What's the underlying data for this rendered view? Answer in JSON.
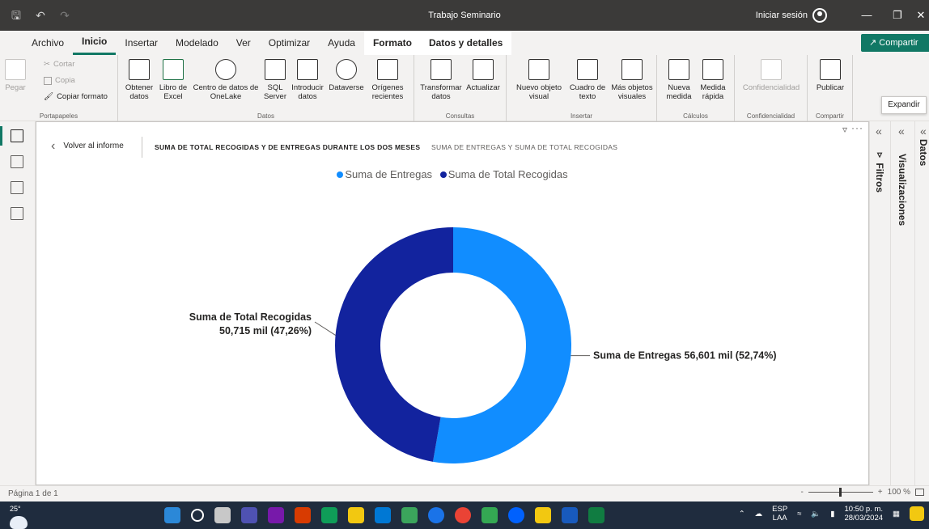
{
  "window": {
    "title": "Trabajo Seminario",
    "signin": "Iniciar sesión"
  },
  "menu": {
    "items": [
      "Archivo",
      "Inicio",
      "Insertar",
      "Modelado",
      "Ver",
      "Optimizar",
      "Ayuda",
      "Formato",
      "Datos y detalles"
    ],
    "share": "Compartir"
  },
  "ribbon": {
    "portapapeles": {
      "label": "Portapapeles",
      "pegar": "Pegar",
      "cortar": "Cortar",
      "copia": "Copia",
      "copiar_formato": "Copiar formato"
    },
    "datos": {
      "label": "Datos",
      "obtener": "Obtener datos",
      "libro": "Libro de Excel",
      "centro": "Centro de datos de OneLake",
      "sql": "SQL Server",
      "introducir": "Introducir datos",
      "dataverse": "Dataverse",
      "origenes": "Orígenes recientes"
    },
    "consultas": {
      "label": "Consultas",
      "transformar": "Transformar datos",
      "actualizar": "Actualizar"
    },
    "insertar": {
      "label": "Insertar",
      "nuevo_objeto": "Nuevo objeto visual",
      "cuadro": "Cuadro de texto",
      "mas": "Más objetos visuales"
    },
    "calculos": {
      "label": "Cálculos",
      "nueva_medida": "Nueva medida",
      "medida_rapida": "Medida rápida"
    },
    "confidencialidad": {
      "label": "Confidencialidad",
      "btn": "Confidencialidad"
    },
    "compartir": {
      "label": "Compartir",
      "publicar": "Publicar"
    }
  },
  "tooltip": "Expandir",
  "report": {
    "back": "Volver al informe",
    "crumb_active": "SUMA DE TOTAL RECOGIDAS Y DE ENTREGAS DURANTE LOS DOS MESES",
    "crumb_other": "SUMA DE ENTREGAS Y SUMA DE TOTAL RECOGIDAS"
  },
  "panes": {
    "filtros": "Filtros",
    "visualizaciones": "Visualizaciones",
    "datos": "Datos"
  },
  "chart_data": {
    "type": "pie",
    "variant": "donut",
    "series": [
      {
        "name": "Suma de Entregas",
        "value": 56601,
        "percent": 52.74,
        "label": "Suma de Entregas 56,601 mil (52,74%)",
        "color": "#118dff"
      },
      {
        "name": "Suma de Total Recogidas",
        "value": 50715,
        "percent": 47.26,
        "label_line1": "Suma de Total Recogidas",
        "label_line2": "50,715 mil (47,26%)",
        "color": "#12239e"
      }
    ],
    "legend_position": "top-center"
  },
  "status": {
    "page": "Página 1 de 1",
    "zoom": "100 %"
  },
  "taskbar": {
    "temp": "25°",
    "lang1": "ESP",
    "lang2": "LAA",
    "time": "10:50 p. m.",
    "date": "28/03/2024"
  }
}
